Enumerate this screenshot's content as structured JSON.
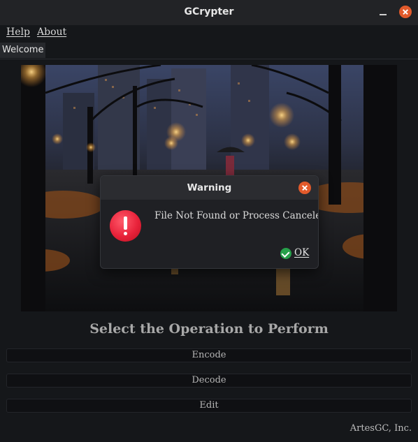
{
  "window": {
    "title": "GCrypter"
  },
  "menu": {
    "items": [
      {
        "label": "Help"
      },
      {
        "label": "About"
      }
    ]
  },
  "tabs": [
    {
      "label": "Welcome"
    }
  ],
  "main": {
    "heading": "Select the Operation to Perform",
    "buttons": [
      {
        "label": "Encode"
      },
      {
        "label": "Decode"
      },
      {
        "label": "Edit"
      }
    ],
    "footer": "ArtesGC, Inc."
  },
  "dialog": {
    "title": "Warning",
    "message": "File Not Found or Process Canceled!",
    "ok_label": "OK",
    "icon": "error-exclamation-icon"
  },
  "colors": {
    "accent_close": "#e25a2b",
    "warning_red": "#e8223a",
    "ok_green": "#26a04a"
  }
}
